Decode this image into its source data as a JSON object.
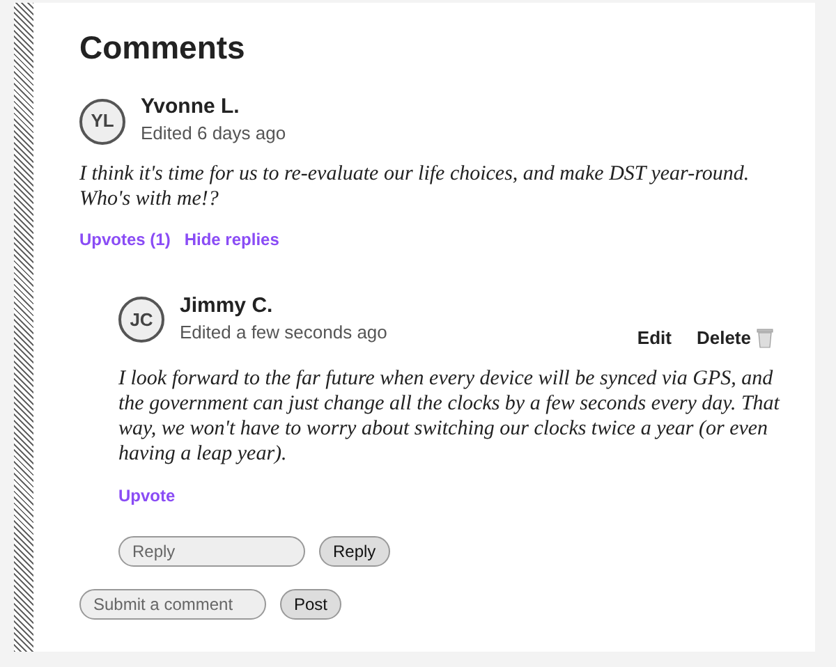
{
  "title": "Comments",
  "comment": {
    "initials": "YL",
    "author": "Yvonne L.",
    "meta": "Edited 6 days ago",
    "body": "I think it's time for us to re-evaluate our life choices, and make DST year-round. Who's with me!?",
    "actions": [
      "Upvotes (1)",
      "Hide replies"
    ]
  },
  "reply": {
    "initials": "JC",
    "author": "Jimmy C.",
    "meta": "Edited a few seconds ago",
    "edit": "Edit",
    "delete": "Delete",
    "body": "I look forward to the far future when every device will be synced via GPS, and the government can just change all the clocks by a few seconds every day. That way, we won't have to worry about switching our clocks twice a year (or even having a leap year).",
    "actions": [
      "Upvote"
    ]
  },
  "reply_form": {
    "placeholder": "Reply",
    "button": "Reply"
  },
  "comment_form": {
    "placeholder": "Submit a comment",
    "button": "Post"
  }
}
